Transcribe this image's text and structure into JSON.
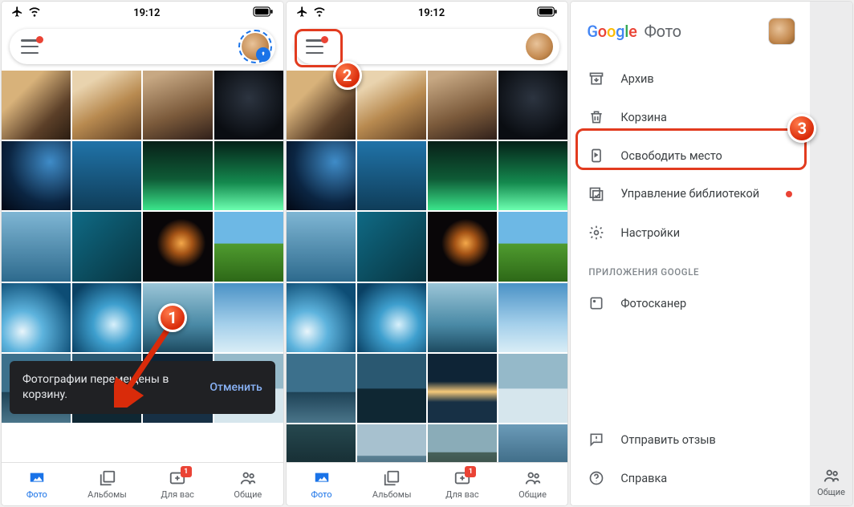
{
  "status": {
    "time": "19:12"
  },
  "nav": {
    "photos": "Фото",
    "albums": "Альбомы",
    "foryou": "Для вас",
    "shared": "Общие",
    "badge": "1"
  },
  "toast": {
    "message": "Фотографии перемещены в корзину.",
    "action": "Отменить"
  },
  "drawer": {
    "brand_photo": "Фото",
    "archive": "Архив",
    "trash": "Корзина",
    "free_space": "Освободить место",
    "manage_library": "Управление библиотекой",
    "settings": "Настройки",
    "section_apps": "ПРИЛОЖЕНИЯ GOOGLE",
    "photoscan": "Фотосканер",
    "feedback": "Отправить отзыв",
    "help": "Справка"
  },
  "steps": {
    "s1": "1",
    "s2": "2",
    "s3": "3"
  }
}
